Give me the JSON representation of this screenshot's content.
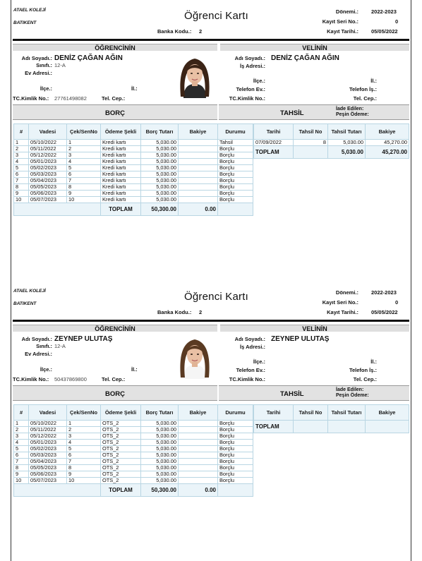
{
  "labels": {
    "term": "Dönemi.:",
    "serial": "Kayıt Seri No.:",
    "reg_date": "Kayıt Tarihi.:",
    "bank_code": "Banka Kodu.:",
    "student_section": "ÖĞRENCİNİN",
    "parent_section": "VELİNİN",
    "full_name": "Adı Soyadı.:",
    "class": "Sınıfı.:",
    "home_address": "Ev Adresi.:",
    "work_address": "İş Adresi.:",
    "district": "İlçe.:",
    "city": "İl.:",
    "home_phone": "Telefon Ev.:",
    "work_phone": "Telefon İş.:",
    "id_no": "TC.Kimlik No.:",
    "mobile": "Tel. Cep.:",
    "debt": "BORÇ",
    "collection": "TAHSİL",
    "refunded": "İade Edilen:",
    "advance": "Peşin Ödeme:",
    "total": "TOPLAM"
  },
  "debt_headers": [
    "#",
    "Vadesi",
    "Çek/SenNo",
    "Ödeme Şekli",
    "Borç Tutarı",
    "Bakiye",
    "Durumu"
  ],
  "collection_headers": [
    "Tarihi",
    "Tahsil No",
    "Tahsil Tutarı",
    "Bakiye"
  ],
  "cards": [
    {
      "school": "ATAEL KOLEJİ",
      "branch": "BATIKENT",
      "title": "Öğrenci Kartı",
      "term": "2022-2023",
      "serial": "0",
      "reg_date": "05/05/2022",
      "bank_code": "2",
      "student": {
        "name": "DENİZ ÇAĞAN AĞIN",
        "class": "12-A",
        "id_no": "27761498082"
      },
      "parent": {
        "name": "DENİZ ÇAĞAN AĞIN"
      },
      "debts": [
        [
          "1",
          "05/10/2022",
          "1",
          "Kredi kartı",
          "5,030.00",
          "",
          "Tahsil"
        ],
        [
          "2",
          "05/11/2022",
          "2",
          "Kredi kartı",
          "5,030.00",
          "",
          "Borçlu"
        ],
        [
          "3",
          "05/12/2022",
          "3",
          "Kredi kartı",
          "5,030.00",
          "",
          "Borçlu"
        ],
        [
          "4",
          "05/01/2023",
          "4",
          "Kredi kartı",
          "5,030.00",
          "",
          "Borçlu"
        ],
        [
          "5",
          "05/02/2023",
          "5",
          "Kredi kartı",
          "5,030.00",
          "",
          "Borçlu"
        ],
        [
          "6",
          "05/03/2023",
          "6",
          "Kredi kartı",
          "5,030.00",
          "",
          "Borçlu"
        ],
        [
          "7",
          "05/04/2023",
          "7",
          "Kredi kartı",
          "5,030.00",
          "",
          "Borçlu"
        ],
        [
          "8",
          "05/05/2023",
          "8",
          "Kredi kartı",
          "5,030.00",
          "",
          "Borçlu"
        ],
        [
          "9",
          "05/06/2023",
          "9",
          "Kredi kartı",
          "5,030.00",
          "",
          "Borçlu"
        ],
        [
          "10",
          "05/07/2023",
          "10",
          "Kredi kartı",
          "5,030.00",
          "",
          "Borçlu"
        ]
      ],
      "debt_total": "50,300.00",
      "debt_balance_total": "0.00",
      "collections": [
        [
          "07/09/2022",
          "8",
          "5,030.00",
          "45,270.00"
        ]
      ],
      "collection_total": "5,030.00",
      "collection_balance_total": "45,270.00"
    },
    {
      "school": "ATAEL KOLEJİ",
      "branch": "BATIKENT",
      "title": "Öğrenci Kartı",
      "term": "2022-2023",
      "serial": "0",
      "reg_date": "05/05/2022",
      "bank_code": "2",
      "student": {
        "name": "ZEYNEP ULUTAŞ",
        "class": "12-A",
        "id_no": "50437869800"
      },
      "parent": {
        "name": "ZEYNEP ULUTAŞ"
      },
      "debts": [
        [
          "1",
          "05/10/2022",
          "1",
          "OTS_2",
          "5,030.00",
          "",
          "Borçlu"
        ],
        [
          "2",
          "05/11/2022",
          "2",
          "OTS_2",
          "5,030.00",
          "",
          "Borçlu"
        ],
        [
          "3",
          "05/12/2022",
          "3",
          "OTS_2",
          "5,030.00",
          "",
          "Borçlu"
        ],
        [
          "4",
          "05/01/2023",
          "4",
          "OTS_2",
          "5,030.00",
          "",
          "Borçlu"
        ],
        [
          "5",
          "05/02/2023",
          "5",
          "OTS_2",
          "5,030.00",
          "",
          "Borçlu"
        ],
        [
          "6",
          "05/03/2023",
          "6",
          "OTS_2",
          "5,030.00",
          "",
          "Borçlu"
        ],
        [
          "7",
          "05/04/2023",
          "7",
          "OTS_2",
          "5,030.00",
          "",
          "Borçlu"
        ],
        [
          "8",
          "05/05/2023",
          "8",
          "OTS_2",
          "5,030.00",
          "",
          "Borçlu"
        ],
        [
          "9",
          "05/06/2023",
          "9",
          "OTS_2",
          "5,030.00",
          "",
          "Borçlu"
        ],
        [
          "10",
          "05/07/2023",
          "10",
          "OTS_2",
          "5,030.00",
          "",
          "Borçlu"
        ]
      ],
      "debt_total": "50,300.00",
      "debt_balance_total": "0.00",
      "collections": [],
      "collection_total": "",
      "collection_balance_total": ""
    }
  ]
}
